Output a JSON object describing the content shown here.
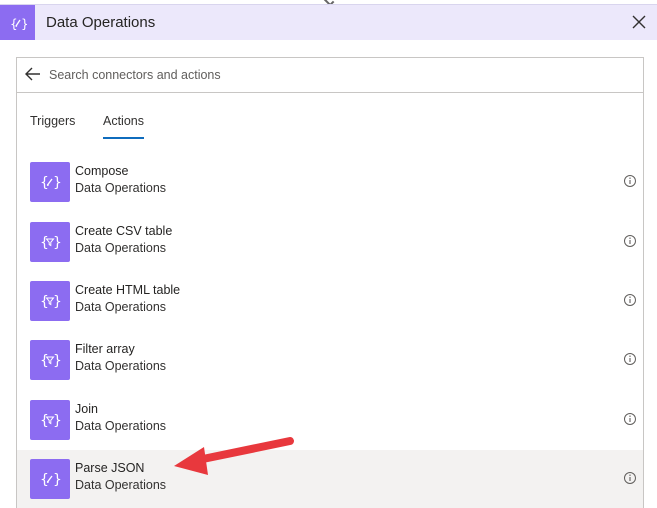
{
  "header": {
    "title": "Data Operations",
    "icon": "data-operations-icon",
    "brand_color": "#8c6cf1",
    "header_bg": "#ece8fb"
  },
  "search": {
    "placeholder": "Search connectors and actions",
    "value": ""
  },
  "tabs": [
    {
      "label": "Triggers",
      "active": false
    },
    {
      "label": "Actions",
      "active": true
    }
  ],
  "actions": [
    {
      "title": "Compose",
      "subtitle": "Data Operations",
      "icon": "compose-icon"
    },
    {
      "title": "Create CSV table",
      "subtitle": "Data Operations",
      "icon": "filter-icon"
    },
    {
      "title": "Create HTML table",
      "subtitle": "Data Operations",
      "icon": "filter-icon"
    },
    {
      "title": "Filter array",
      "subtitle": "Data Operations",
      "icon": "filter-icon"
    },
    {
      "title": "Join",
      "subtitle": "Data Operations",
      "icon": "filter-icon"
    },
    {
      "title": "Parse JSON",
      "subtitle": "Data Operations",
      "icon": "compose-icon",
      "highlighted": true
    }
  ],
  "annotation": {
    "arrow_color": "#e8383d",
    "points_to": "Parse JSON"
  }
}
